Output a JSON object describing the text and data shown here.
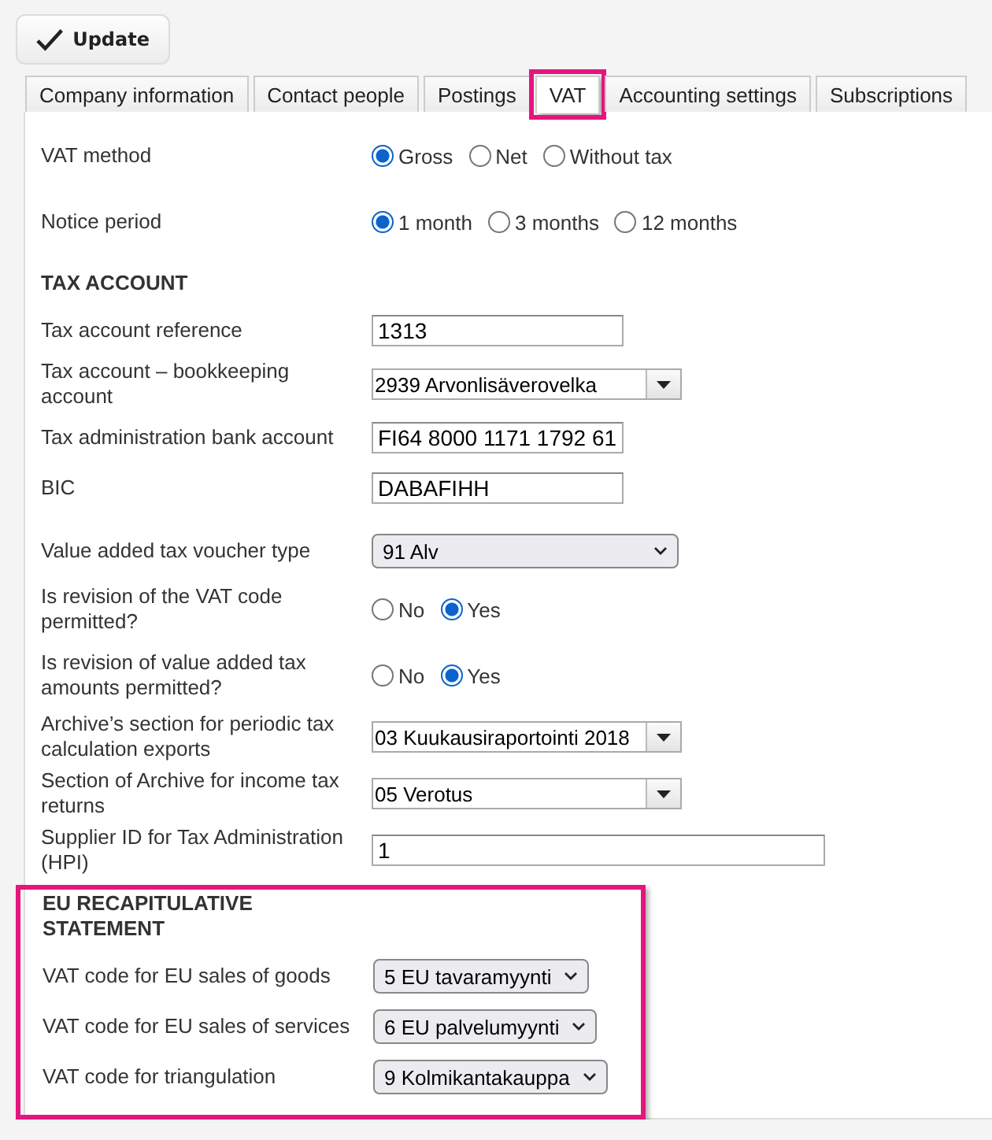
{
  "toolbar": {
    "update_button": "Update"
  },
  "tabs": [
    {
      "label": "Company information",
      "selected": false,
      "highlighted": false
    },
    {
      "label": "Contact people",
      "selected": false,
      "highlighted": false
    },
    {
      "label": "Postings",
      "selected": false,
      "highlighted": false
    },
    {
      "label": "VAT",
      "selected": true,
      "highlighted": true
    },
    {
      "label": "Accounting settings",
      "selected": false,
      "highlighted": false
    },
    {
      "label": "Subscriptions",
      "selected": false,
      "highlighted": false
    }
  ],
  "sections": [
    {
      "highlighted": false,
      "rows": [
        {
          "kind": "radio",
          "label": "VAT method",
          "options": [
            {
              "label": "Gross",
              "selected": true
            },
            {
              "label": "Net",
              "selected": false
            },
            {
              "label": "Without tax",
              "selected": false
            }
          ]
        },
        {
          "kind": "radio",
          "label": "Notice period",
          "options": [
            {
              "label": "1 month",
              "selected": true
            },
            {
              "label": "3 months",
              "selected": false
            },
            {
              "label": "12 months",
              "selected": false
            }
          ]
        }
      ]
    },
    {
      "heading": "TAX ACCOUNT",
      "highlighted": false,
      "rows": [
        {
          "kind": "field",
          "label": "Tax account reference",
          "value": "1313"
        },
        {
          "kind": "combo",
          "label": "Tax account – bookkeeping account",
          "value": "2939 Arvonlisäverovelka"
        },
        {
          "kind": "field",
          "label": "Tax administration bank account",
          "value": "FI64 8000 1171 1792 61"
        },
        {
          "kind": "field",
          "label": "BIC",
          "value": "DABAFIHH"
        }
      ]
    },
    {
      "highlighted": false,
      "rows": [
        {
          "kind": "select",
          "label": "Value added tax voucher type",
          "value": "91 Alv"
        },
        {
          "kind": "radio",
          "label": "Is revision of the VAT code permitted?",
          "options": [
            {
              "label": "No",
              "selected": false
            },
            {
              "label": "Yes",
              "selected": true
            }
          ]
        },
        {
          "kind": "radio",
          "label": "Is revision of value added tax amounts permitted?",
          "options": [
            {
              "label": "No",
              "selected": false
            },
            {
              "label": "Yes",
              "selected": true
            }
          ]
        },
        {
          "kind": "combo",
          "label": "Archive’s section for periodic tax calculation exports",
          "value": "03 Kuukausiraportointi 2018"
        },
        {
          "kind": "combo",
          "label": "Section of Archive for income tax returns",
          "value": "05 Verotus"
        },
        {
          "kind": "widefield",
          "label": "Supplier ID for Tax Administration (HPI)",
          "value": "1"
        }
      ]
    },
    {
      "heading": "EU RECAPITULATIVE STATEMENT",
      "highlighted": true,
      "rows": [
        {
          "kind": "compactselect",
          "label": "VAT code for EU sales of goods",
          "value": "5 EU tavaramyynti"
        },
        {
          "kind": "compactselect",
          "label": "VAT code for EU sales of services",
          "value": "6 EU palvelumyynti"
        },
        {
          "kind": "compactselect",
          "label": "VAT code for triangulation",
          "value": "9 Kolmikantakauppa"
        }
      ]
    }
  ]
}
